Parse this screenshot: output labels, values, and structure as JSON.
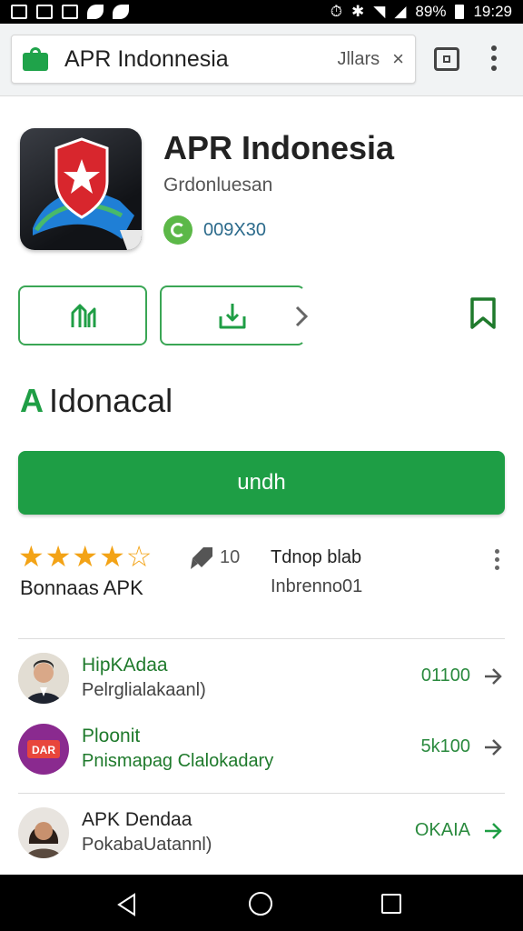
{
  "status_bar": {
    "battery": "89%",
    "time": "19:29"
  },
  "browser": {
    "url": "APR Indonnesia",
    "url_suffix": "Jllars",
    "close": "×"
  },
  "app": {
    "title": "APR Indonesia",
    "developer": "Grdonluesan",
    "badge_value": "009X30"
  },
  "section": {
    "letter": "A",
    "title": "Idonacal"
  },
  "install": {
    "label": "undh"
  },
  "rating": {
    "stars_filled": 4,
    "stars_total": 5,
    "label": "Bonnaas APK",
    "tag_count": "10",
    "info_title": "Tdnop blab",
    "info_sub": "Inbrenno01"
  },
  "list": [
    {
      "title": "HipKAdaa",
      "subtitle": "Pelrglialakaanl)",
      "value": "01100",
      "title_color": "#1f7a2c",
      "sub_color": "#444444"
    },
    {
      "title": "Ploonit",
      "subtitle": "Pnismapag Clalokadary",
      "value": "5k100",
      "title_color": "#1f7a2c",
      "sub_color": "#1f7a2c"
    },
    {
      "title": "APK Dendaa",
      "subtitle": "PokabaUatannl)",
      "value": "OKAIA",
      "title_color": "#222222",
      "sub_color": "#444444"
    }
  ],
  "colors": {
    "accent": "#1e9e45",
    "star": "#f3a316",
    "link": "#2b6a8b"
  }
}
